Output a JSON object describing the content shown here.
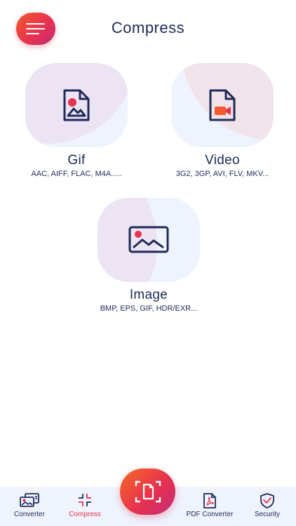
{
  "header": {
    "title": "Compress"
  },
  "colors": {
    "accent": "#e8324e",
    "accent_orange": "#f25a2c",
    "navy": "#1f2a5a",
    "tile_bg": "#eef3fd",
    "tile_blob": "#ece3f3"
  },
  "tiles": [
    {
      "label": "Gif",
      "formats": "AAC, AIFF, FLAC, M4A.....",
      "icon": "gif-file-icon"
    },
    {
      "label": "Video",
      "formats": "3G2, 3GP, AVI, FLV, MKV...",
      "icon": "video-file-icon"
    },
    {
      "label": "Image",
      "formats": "BMP, EPS, GIF, HDR/EXR...",
      "icon": "image-icon"
    }
  ],
  "bottom_nav": {
    "items": [
      {
        "label": "Converter",
        "icon": "converter-icon"
      },
      {
        "label": "Compress",
        "icon": "compress-icon",
        "active": true
      },
      {
        "label": "PDF Converter",
        "icon": "pdf-icon"
      },
      {
        "label": "Security",
        "icon": "shield-icon"
      }
    ],
    "fab_icon": "scan-document-icon"
  }
}
